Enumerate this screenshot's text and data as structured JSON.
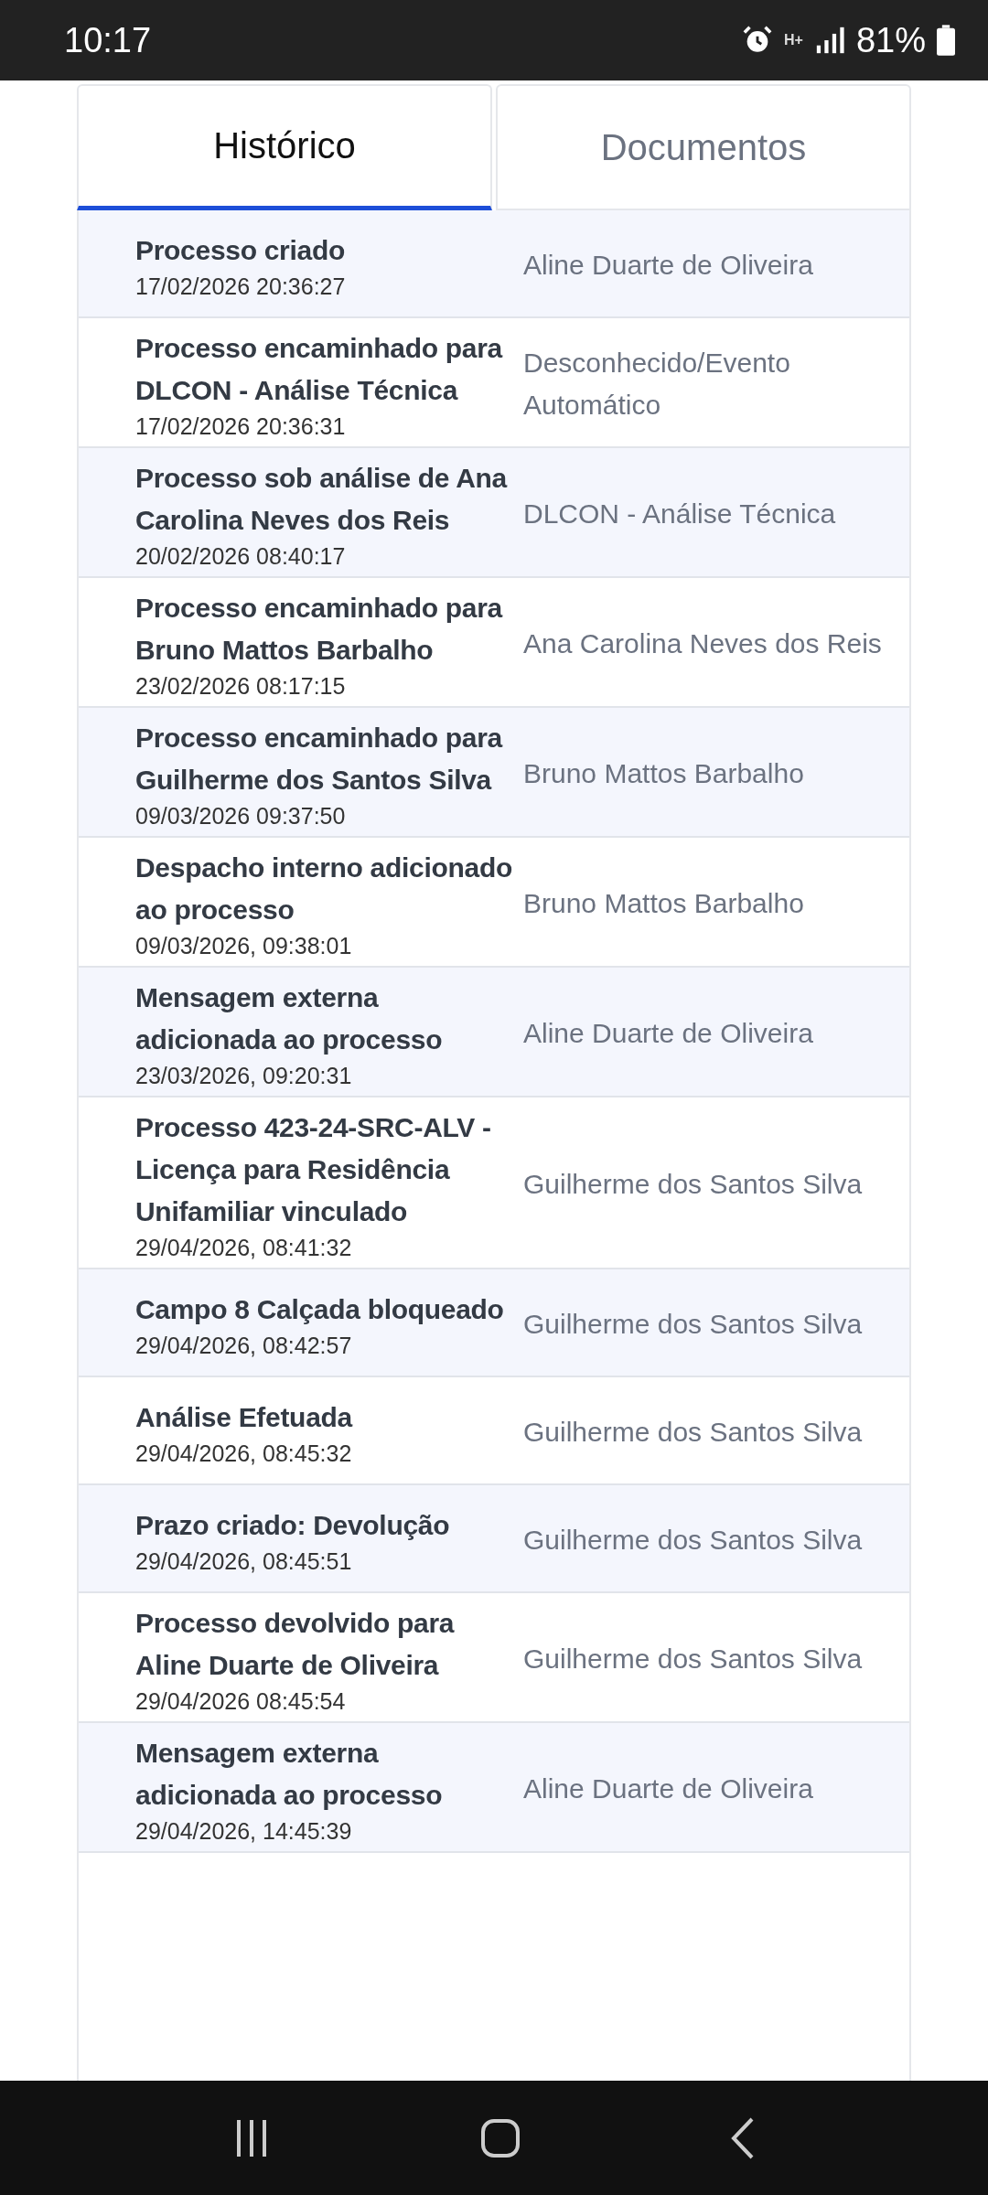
{
  "status_bar": {
    "time": "10:17",
    "network": "H+",
    "battery": "81%"
  },
  "tabs": [
    {
      "label": "Histórico",
      "selected": true
    },
    {
      "label": "Documentos",
      "selected": false
    }
  ],
  "history": [
    {
      "title": "Processo criado",
      "date": "17/02/2026 20:36:27",
      "author": "Aline Duarte de Oliveira"
    },
    {
      "title": "Processo encaminhado para DLCON - Análise Técnica",
      "date": "17/02/2026 20:36:31",
      "author": "Desconhecido/Evento Automático"
    },
    {
      "title": "Processo sob análise de Ana Carolina Neves dos Reis",
      "date": "20/02/2026 08:40:17",
      "author": "DLCON - Análise Técnica"
    },
    {
      "title": "Processo encaminhado para Bruno Mattos Barbalho",
      "date": "23/02/2026 08:17:15",
      "author": "Ana Carolina Neves dos Reis"
    },
    {
      "title": "Processo encaminhado para Guilherme dos Santos Silva",
      "date": "09/03/2026 09:37:50",
      "author": "Bruno Mattos Barbalho"
    },
    {
      "title": "Despacho interno adicionado ao processo",
      "date": "09/03/2026, 09:38:01",
      "author": "Bruno Mattos Barbalho"
    },
    {
      "title": "Mensagem externa adicionada ao processo",
      "date": "23/03/2026, 09:20:31",
      "author": "Aline Duarte de Oliveira"
    },
    {
      "title": "Processo 423-24-SRC-ALV - Licença para Residência Unifamiliar vinculado",
      "date": "29/04/2026, 08:41:32",
      "author": "Guilherme dos Santos Silva"
    },
    {
      "title": "Campo 8 Calçada bloqueado",
      "date": "29/04/2026, 08:42:57",
      "author": "Guilherme dos Santos Silva"
    },
    {
      "title": "Análise Efetuada",
      "date": "29/04/2026, 08:45:32",
      "author": "Guilherme dos Santos Silva"
    },
    {
      "title": "Prazo criado: Devolução",
      "date": "29/04/2026, 08:45:51",
      "author": "Guilherme dos Santos Silva"
    },
    {
      "title": "Processo devolvido para Aline Duarte de Oliveira",
      "date": "29/04/2026 08:45:54",
      "author": "Guilherme dos Santos Silva"
    },
    {
      "title": "Mensagem externa adicionada ao processo",
      "date": "29/04/2026, 14:45:39",
      "author": "Aline Duarte de Oliveira"
    }
  ]
}
